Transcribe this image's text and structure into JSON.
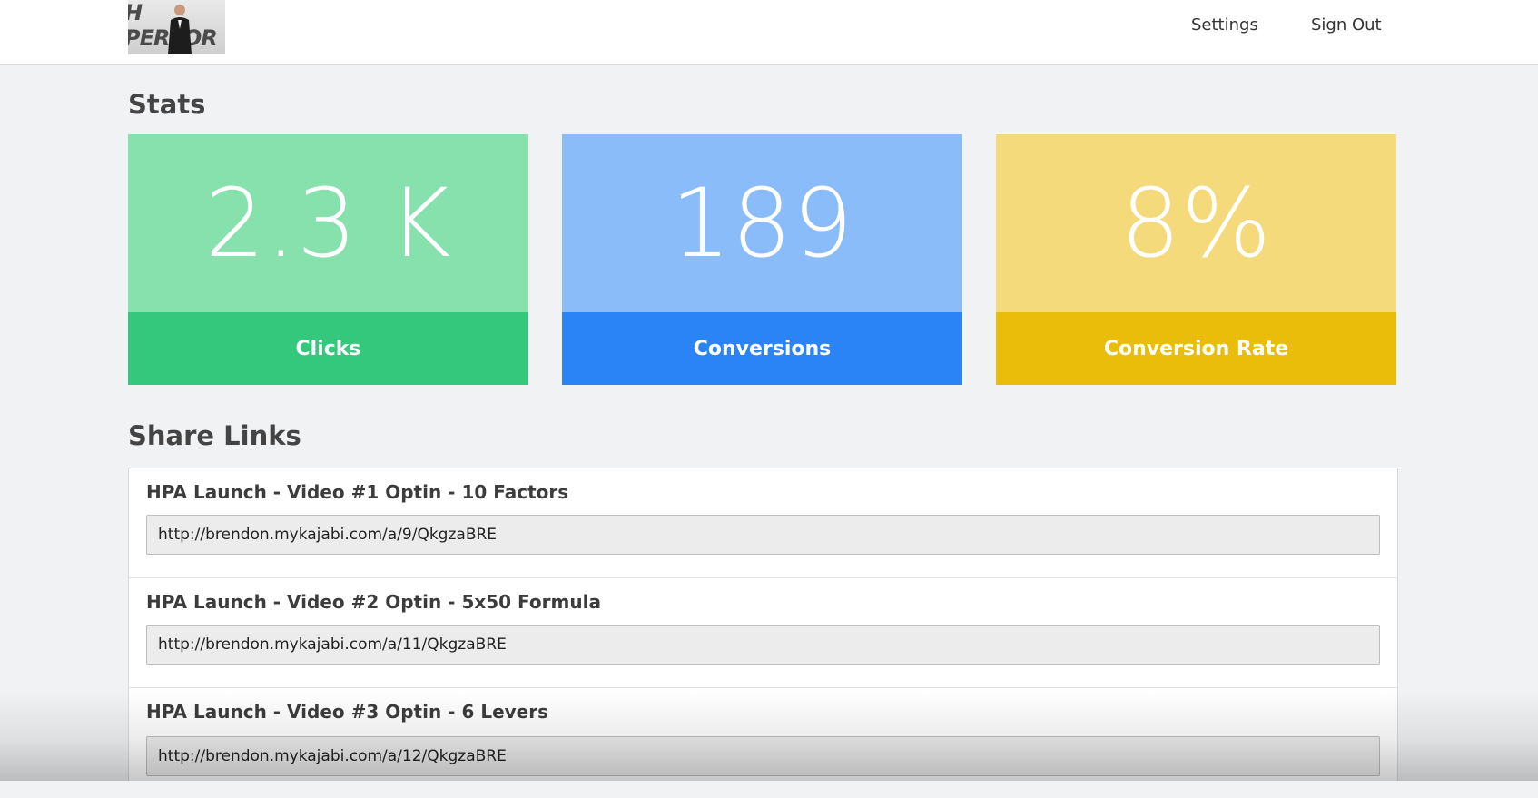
{
  "header": {
    "logo_text": "H PERFOR\nDEMY",
    "nav": {
      "settings_label": "Settings",
      "signout_label": "Sign Out"
    }
  },
  "stats": {
    "title": "Stats",
    "cards": [
      {
        "value": "2.3 K",
        "label": "Clicks",
        "top_color": "#87e1ad",
        "bottom_color": "#33c87c"
      },
      {
        "value": "189",
        "label": "Conversions",
        "top_color": "#8bbcfa",
        "bottom_color": "#2a84f5"
      },
      {
        "value": "8%",
        "label": "Conversion Rate",
        "top_color": "#f5da7c",
        "bottom_color": "#e9bd09"
      }
    ]
  },
  "share_links": {
    "title": "Share Links",
    "items": [
      {
        "title": "HPA Launch - Video #1 Optin - 10 Factors",
        "url": "http://brendon.mykajabi.com/a/9/QkgzaBRE"
      },
      {
        "title": "HPA Launch - Video #2 Optin - 5x50 Formula",
        "url": "http://brendon.mykajabi.com/a/11/QkgzaBRE"
      },
      {
        "title": "HPA Launch - Video #3 Optin - 6 Levers",
        "url": "http://brendon.mykajabi.com/a/12/QkgzaBRE"
      }
    ]
  }
}
